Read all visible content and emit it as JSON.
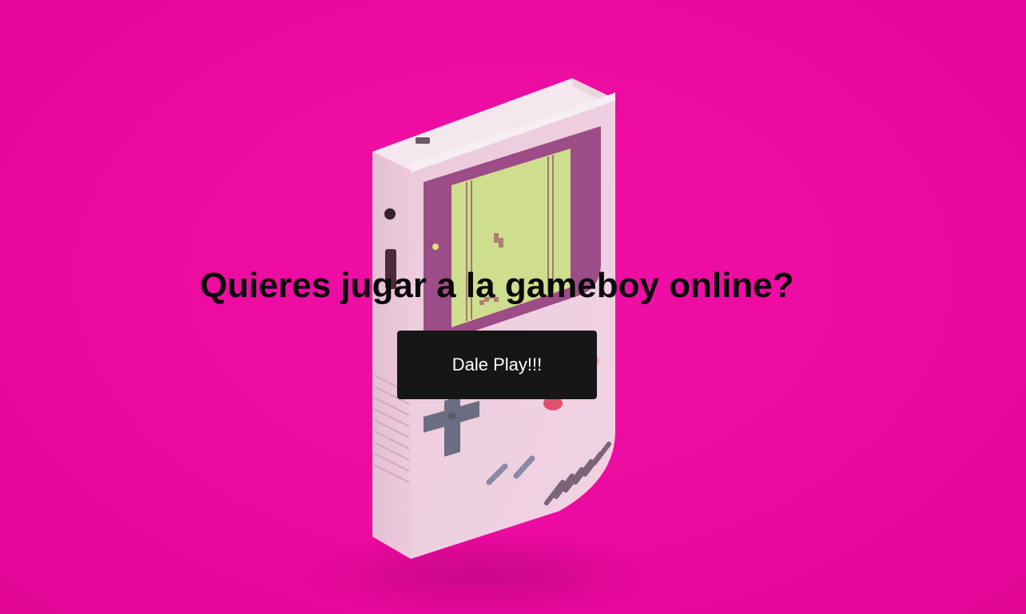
{
  "hero": {
    "title": "Quieres jugar a la gameboy online?",
    "play_button_label": "Dale Play!!!",
    "background_color": "#ec0a9f",
    "button_color": "#161616",
    "illustration": "gameboy-console-icon"
  }
}
